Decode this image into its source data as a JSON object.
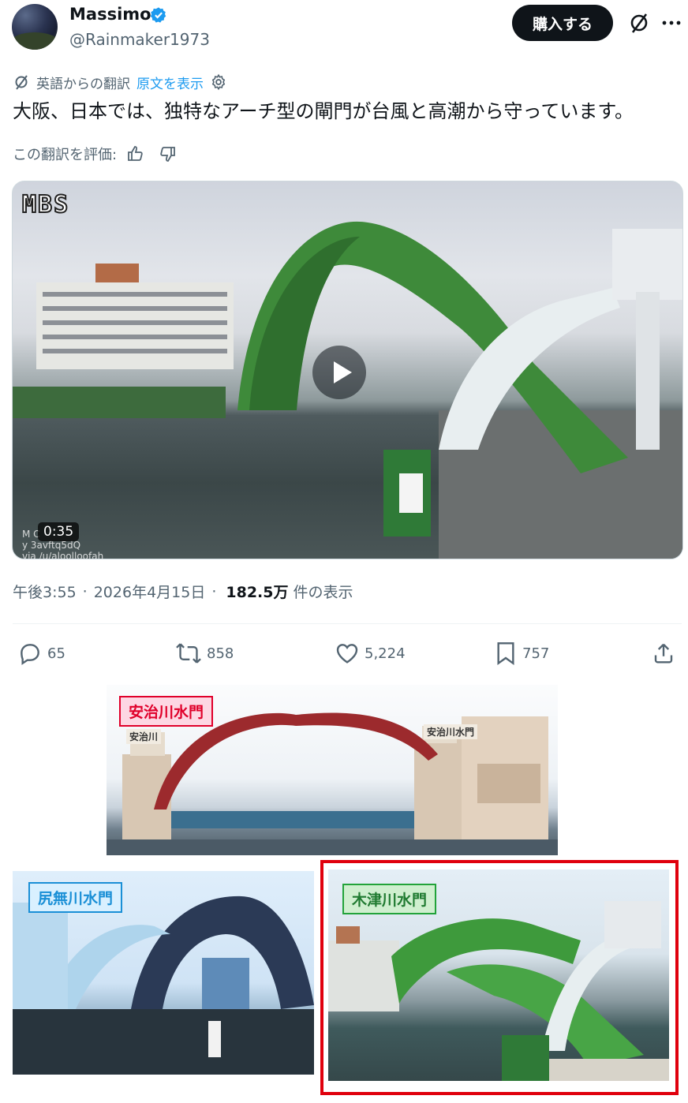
{
  "author": {
    "name": "Massimo",
    "handle": "@Rainmaker1973",
    "buy_label": "購入する",
    "verified_color": "#1d9bf0"
  },
  "translation": {
    "source_label": "英語からの翻訳",
    "show_original": "原文を表示",
    "text": "大阪、日本では、独特なアーチ型の閘門が台風と高潮から守っています。",
    "rate_label": "この翻訳を評価:"
  },
  "video": {
    "logo": "MBS",
    "duration": "0:35",
    "credit_line1": "M      C",
    "credit_line2": "y        3avftq5dQ",
    "credit_line3": "via /u/aloolloofah"
  },
  "meta": {
    "time": "午後3:55",
    "date": "2026年4月15日",
    "views_count": "182.5万",
    "views_suffix": "件の表示",
    "sep": "·"
  },
  "actions": {
    "replies": "65",
    "reposts": "858",
    "likes": "5,224",
    "bookmarks": "757"
  },
  "collage": {
    "top_label": "安治川水門",
    "left_label": "尻無川水門",
    "right_label": "木津川水門",
    "sign_ajikawa": "安治川",
    "sign_ajikawa_gate": "安治川水門",
    "colors": {
      "top_label": "#e0002a",
      "left_label": "#1a8fd6",
      "right_label": "#22a33a",
      "highlight": "#e0000d"
    }
  }
}
